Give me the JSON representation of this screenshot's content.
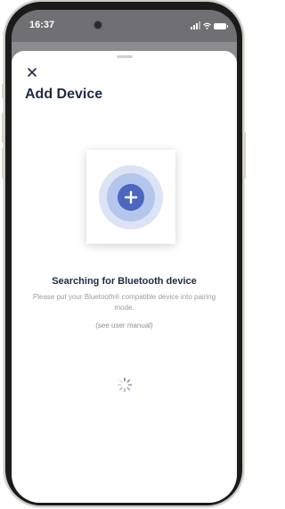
{
  "status_bar": {
    "time": "16:37"
  },
  "sheet": {
    "title": "Add Device",
    "search_title": "Searching for Bluetooth device",
    "instructions": "Please put your Bluetooth® compatible device into pairing mode.",
    "manual_link": "(see user manual)"
  },
  "icons": {
    "close": "close-icon",
    "add": "plus-icon",
    "loading": "spinner-icon",
    "signal": "signal-icon",
    "wifi": "wifi-icon",
    "battery": "battery-icon"
  },
  "colors": {
    "accent": "#4b67c0",
    "ring_inner": "#b5c6ec",
    "ring_outer": "#dbe3f5",
    "title": "#1e2a44",
    "muted_text": "#9a9ea6"
  }
}
